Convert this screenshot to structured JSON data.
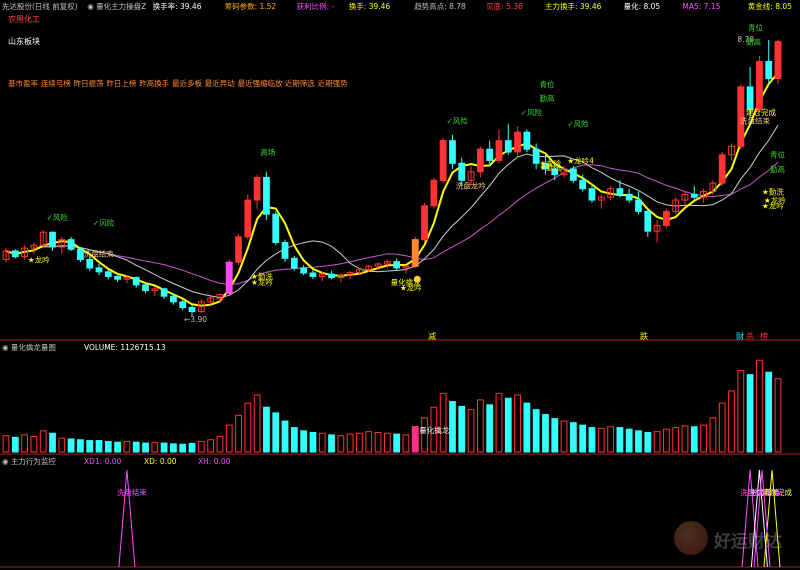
{
  "header": {
    "row1": [
      {
        "text": "先达股份(日线 前复权)",
        "color": "#c0c0c0"
      },
      {
        "text": "◉ 量化主力操盘Z",
        "color": "#c0c0c0"
      },
      {
        "text": "换手率: 39.46",
        "color": "#ffffff"
      },
      {
        "text": "筹码参数: 1.52",
        "color": "#ffaa00"
      },
      {
        "text": "获利比例: -",
        "color": "#ff4dff"
      },
      {
        "text": "换手: 39.46",
        "color": "#ffff00"
      },
      {
        "text": "趋势高点: 8.78",
        "color": "#c0c0c0"
      },
      {
        "text": "见底: 5.36",
        "color": "#ff4444"
      },
      {
        "text": "主力换手: 39.46",
        "color": "#ffff00"
      },
      {
        "text": "量化: 8.05",
        "color": "#ffffff"
      },
      {
        "text": "MA5: 7.15",
        "color": "#ff4dff"
      },
      {
        "text": "黄金线: 8.05",
        "color": "#ffff00"
      }
    ],
    "sector1": "农用化工",
    "sector2": "山东板块",
    "tags": [
      "基市盈率",
      "连续弓榜",
      "昨日振荡",
      "昨日上榜",
      "昨高换手",
      "最近多板",
      "最近异动",
      "最近强缩临放",
      "近期筛选",
      "近期强势"
    ]
  },
  "main_panel": {
    "low_label": "←3.90",
    "high_label": "8.78",
    "annotations": [
      {
        "text": "✓风险",
        "color": "#33dd33"
      },
      {
        "text": "✓风险",
        "color": "#33dd33"
      },
      {
        "text": "★龙吟",
        "color": "#ffff00"
      },
      {
        "text": "洗盘结束",
        "color": "#ffcc88"
      },
      {
        "text": "高场",
        "color": "#33dd33"
      },
      {
        "text": "★龙吟",
        "color": "#ffff00"
      },
      {
        "text": "★勤洗",
        "color": "#ffff00"
      },
      {
        "text": "量化擒龙",
        "color": "#ffff00"
      },
      {
        "text": "★龙吟",
        "color": "#ffff00"
      },
      {
        "text": "✓风险",
        "color": "#33dd33"
      },
      {
        "text": "洗盘龙吟",
        "color": "#ffcc88"
      },
      {
        "text": "青位",
        "color": "#33dd33"
      },
      {
        "text": "勤高",
        "color": "#33dd33"
      },
      {
        "text": "✓风险",
        "color": "#33dd33"
      },
      {
        "text": "✓风险",
        "color": "#33dd33"
      },
      {
        "text": "★龙吟",
        "color": "#ffff00"
      },
      {
        "text": "★龙吟4",
        "color": "#ffff00"
      },
      {
        "text": "★勤洗",
        "color": "#ffff00"
      },
      {
        "text": "青位",
        "color": "#33dd33"
      },
      {
        "text": "勤高",
        "color": "#33dd33"
      },
      {
        "text": "★龙吟",
        "color": "#ffff00"
      },
      {
        "text": "★勤洗",
        "color": "#ffff00"
      },
      {
        "text": "★龙吟",
        "color": "#ffff00"
      },
      {
        "text": "建仓完成",
        "color": "#ffff00"
      },
      {
        "text": "洗盘结束",
        "color": "#ffcc88"
      },
      {
        "text": "青位",
        "color": "#33dd33"
      },
      {
        "text": "勤高",
        "color": "#33dd33"
      }
    ],
    "divider_tags": [
      {
        "text": "减",
        "color": "#ffff00"
      },
      {
        "text": "跌",
        "color": "#ffff00"
      },
      {
        "text": "财",
        "color": "#00ffff"
      },
      {
        "text": "杀",
        "color": "#ff3333"
      },
      {
        "text": "榜",
        "color": "#ff3333"
      }
    ]
  },
  "volume_panel": {
    "title": "◉ 量化擒龙量图",
    "volume_label": "VOLUME: 1126715.13",
    "mark_label": "量化擒龙"
  },
  "indicator_panel": {
    "title": "◉ 主力行为监控",
    "values": [
      {
        "text": "XD1: 0.00",
        "color": "#ff4dff"
      },
      {
        "text": "XD: 0.00",
        "color": "#ffff00"
      },
      {
        "text": "XH: 0.00",
        "color": "#ff4dff"
      }
    ],
    "labels": [
      {
        "text": "洗盘结束",
        "color": "#ff4dff"
      },
      {
        "text": "洗盘结束",
        "color": "#ff4dff"
      },
      {
        "text": "主力暗筹",
        "color": "#ffffff"
      },
      {
        "text": "建仓完成",
        "color": "#ffff00"
      },
      {
        "text": "洗盘结束",
        "color": "#ff4dff"
      }
    ]
  },
  "watermark": "好运财达",
  "colors": {
    "up": "#ff3333",
    "down": "#33ffff",
    "ma_fast": "#ffff00",
    "ma_slow": "#cc55cc",
    "ma_white": "#d0d0d0",
    "bg": "#000000",
    "divider": "#aa2222"
  },
  "chart_data": {
    "type": "candlestick",
    "ohlc": [
      [
        4.9,
        5.1,
        4.85,
        5.05
      ],
      [
        5.05,
        5.08,
        4.92,
        4.95
      ],
      [
        4.95,
        5.15,
        4.9,
        5.1
      ],
      [
        5.1,
        5.2,
        5.0,
        5.15
      ],
      [
        5.15,
        5.42,
        5.1,
        5.38
      ],
      [
        5.38,
        5.4,
        5.05,
        5.12
      ],
      [
        5.12,
        5.3,
        5.0,
        5.25
      ],
      [
        5.25,
        5.3,
        5.05,
        5.08
      ],
      [
        5.08,
        5.1,
        4.85,
        4.9
      ],
      [
        4.9,
        4.95,
        4.7,
        4.75
      ],
      [
        4.75,
        4.82,
        4.62,
        4.68
      ],
      [
        4.68,
        4.72,
        4.55,
        4.6
      ],
      [
        4.6,
        4.66,
        4.5,
        4.55
      ],
      [
        4.55,
        4.62,
        4.48,
        4.58
      ],
      [
        4.58,
        4.6,
        4.4,
        4.45
      ],
      [
        4.45,
        4.5,
        4.3,
        4.35
      ],
      [
        4.35,
        4.42,
        4.25,
        4.38
      ],
      [
        4.38,
        4.4,
        4.2,
        4.25
      ],
      [
        4.25,
        4.3,
        4.1,
        4.15
      ],
      [
        4.15,
        4.2,
        4.0,
        4.05
      ],
      [
        4.05,
        4.1,
        3.9,
        3.98
      ],
      [
        3.98,
        4.2,
        3.95,
        4.15
      ],
      [
        4.15,
        4.25,
        4.1,
        4.22
      ],
      [
        4.2,
        4.3,
        4.15,
        4.28
      ],
      [
        4.3,
        4.9,
        4.28,
        4.85
      ],
      [
        4.85,
        5.35,
        4.8,
        5.3
      ],
      [
        5.3,
        6.05,
        5.25,
        5.95
      ],
      [
        5.95,
        6.4,
        5.8,
        6.35
      ],
      [
        6.35,
        6.45,
        5.6,
        5.7
      ],
      [
        5.7,
        5.75,
        5.15,
        5.2
      ],
      [
        5.2,
        5.25,
        4.85,
        4.92
      ],
      [
        4.92,
        4.96,
        4.7,
        4.75
      ],
      [
        4.75,
        4.8,
        4.62,
        4.66
      ],
      [
        4.66,
        4.72,
        4.55,
        4.6
      ],
      [
        4.6,
        4.68,
        4.52,
        4.64
      ],
      [
        4.64,
        4.7,
        4.55,
        4.58
      ],
      [
        4.58,
        4.65,
        4.5,
        4.62
      ],
      [
        4.62,
        4.7,
        4.55,
        4.67
      ],
      [
        4.67,
        4.75,
        4.62,
        4.72
      ],
      [
        4.72,
        4.8,
        4.68,
        4.78
      ],
      [
        4.78,
        4.85,
        4.72,
        4.82
      ],
      [
        4.82,
        4.9,
        4.75,
        4.86
      ],
      [
        4.86,
        4.92,
        4.7,
        4.75
      ],
      [
        4.75,
        4.8,
        4.65,
        4.78
      ],
      [
        4.78,
        5.3,
        4.75,
        5.25
      ],
      [
        5.25,
        5.9,
        5.2,
        5.85
      ],
      [
        5.85,
        6.35,
        5.8,
        6.3
      ],
      [
        6.3,
        7.05,
        6.25,
        7.0
      ],
      [
        7.0,
        7.1,
        6.5,
        6.6
      ],
      [
        6.6,
        6.7,
        6.2,
        6.3
      ],
      [
        6.3,
        6.55,
        6.2,
        6.45
      ],
      [
        6.45,
        6.9,
        6.35,
        6.85
      ],
      [
        6.85,
        7.0,
        6.55,
        6.65
      ],
      [
        6.65,
        7.2,
        6.6,
        7.0
      ],
      [
        7.0,
        7.3,
        6.75,
        6.8
      ],
      [
        6.8,
        7.25,
        6.7,
        7.15
      ],
      [
        7.15,
        7.2,
        6.8,
        6.85
      ],
      [
        6.85,
        6.95,
        6.5,
        6.6
      ],
      [
        6.6,
        6.75,
        6.4,
        6.5
      ],
      [
        6.5,
        6.6,
        6.3,
        6.4
      ],
      [
        6.4,
        6.55,
        6.35,
        6.5
      ],
      [
        6.5,
        6.55,
        6.25,
        6.3
      ],
      [
        6.3,
        6.4,
        6.1,
        6.15
      ],
      [
        6.15,
        6.25,
        5.9,
        5.95
      ],
      [
        5.95,
        6.05,
        5.8,
        6.0
      ],
      [
        6.0,
        6.2,
        5.95,
        6.15
      ],
      [
        6.15,
        6.3,
        6.0,
        6.05
      ],
      [
        6.05,
        6.15,
        5.9,
        5.95
      ],
      [
        5.95,
        6.1,
        5.7,
        5.75
      ],
      [
        5.75,
        5.8,
        5.3,
        5.4
      ],
      [
        5.4,
        5.6,
        5.2,
        5.5
      ],
      [
        5.5,
        5.8,
        5.45,
        5.75
      ],
      [
        5.75,
        6.0,
        5.7,
        5.95
      ],
      [
        5.95,
        6.1,
        5.85,
        6.05
      ],
      [
        6.05,
        6.2,
        5.95,
        6.0
      ],
      [
        6.0,
        6.15,
        5.9,
        6.1
      ],
      [
        6.1,
        6.3,
        6.05,
        6.25
      ],
      [
        6.25,
        6.8,
        6.2,
        6.75
      ],
      [
        6.75,
        6.95,
        6.65,
        6.9
      ],
      [
        6.9,
        8.0,
        6.85,
        7.95
      ],
      [
        7.95,
        8.3,
        7.4,
        7.55
      ],
      [
        7.55,
        8.5,
        7.5,
        8.4
      ],
      [
        8.4,
        8.78,
        8.0,
        8.1
      ],
      [
        8.1,
        8.78,
        8.0,
        8.75
      ]
    ],
    "volume": [
      200,
      180,
      210,
      190,
      260,
      230,
      170,
      160,
      150,
      140,
      140,
      130,
      120,
      130,
      120,
      110,
      115,
      110,
      100,
      95,
      105,
      130,
      150,
      190,
      330,
      450,
      600,
      700,
      550,
      480,
      380,
      300,
      260,
      240,
      230,
      210,
      200,
      220,
      230,
      250,
      240,
      230,
      220,
      210,
      310,
      420,
      550,
      720,
      620,
      560,
      520,
      640,
      580,
      720,
      660,
      700,
      600,
      520,
      460,
      410,
      380,
      360,
      330,
      300,
      290,
      310,
      300,
      280,
      260,
      240,
      250,
      280,
      300,
      320,
      310,
      330,
      420,
      600,
      750,
      1000,
      950,
      1126.7,
      980,
      900
    ],
    "pulses": [
      13,
      80,
      81,
      84,
      87
    ]
  }
}
